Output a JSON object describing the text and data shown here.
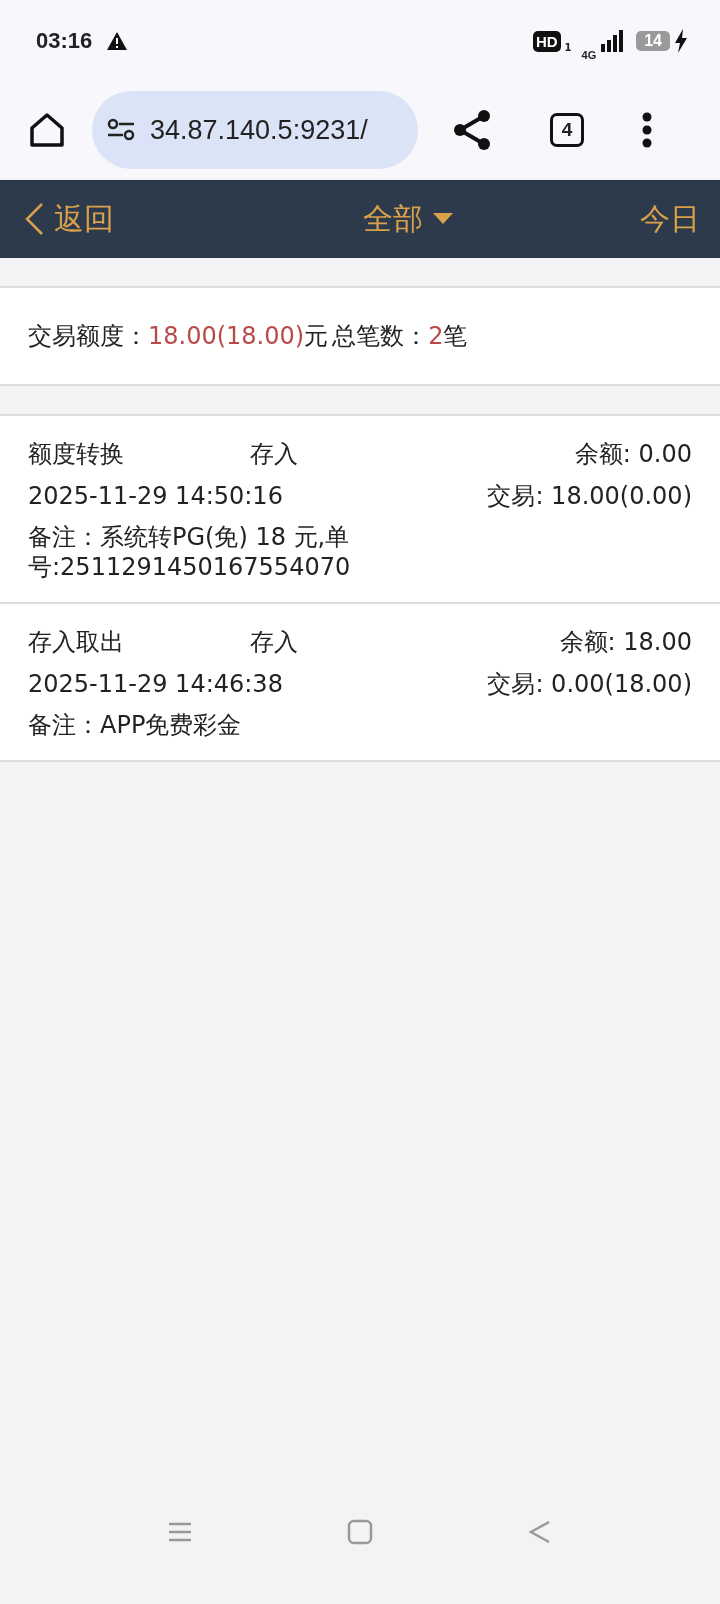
{
  "status_bar": {
    "time": "03:16",
    "hd": "HD",
    "sim": "1",
    "network": "4G",
    "battery": "14",
    "charging": true
  },
  "browser": {
    "url": "34.87.140.5:9231/",
    "tab_count": "4"
  },
  "header": {
    "back": "返回",
    "filter": "全部",
    "today": "今日"
  },
  "summary": {
    "amount_label": "交易额度：",
    "amount": "18.00(18.00)",
    "unit": "元",
    "count_label": "总笔数：",
    "count": "2",
    "count_unit": "笔"
  },
  "records": [
    {
      "type": "额度转换",
      "direction": "存入",
      "balance": "余额: 0.00",
      "datetime": "2025-11-29 14:50:16",
      "trade": "交易: 18.00(0.00)",
      "note": "备注：系统转PG(免) 18 元,单号:2511291450167554070"
    },
    {
      "type": "存入取出",
      "direction": "存入",
      "balance": "余额: 18.00",
      "datetime": "2025-11-29 14:46:38",
      "trade": "交易: 0.00(18.00)",
      "note": "备注：APP免费彩金"
    }
  ]
}
